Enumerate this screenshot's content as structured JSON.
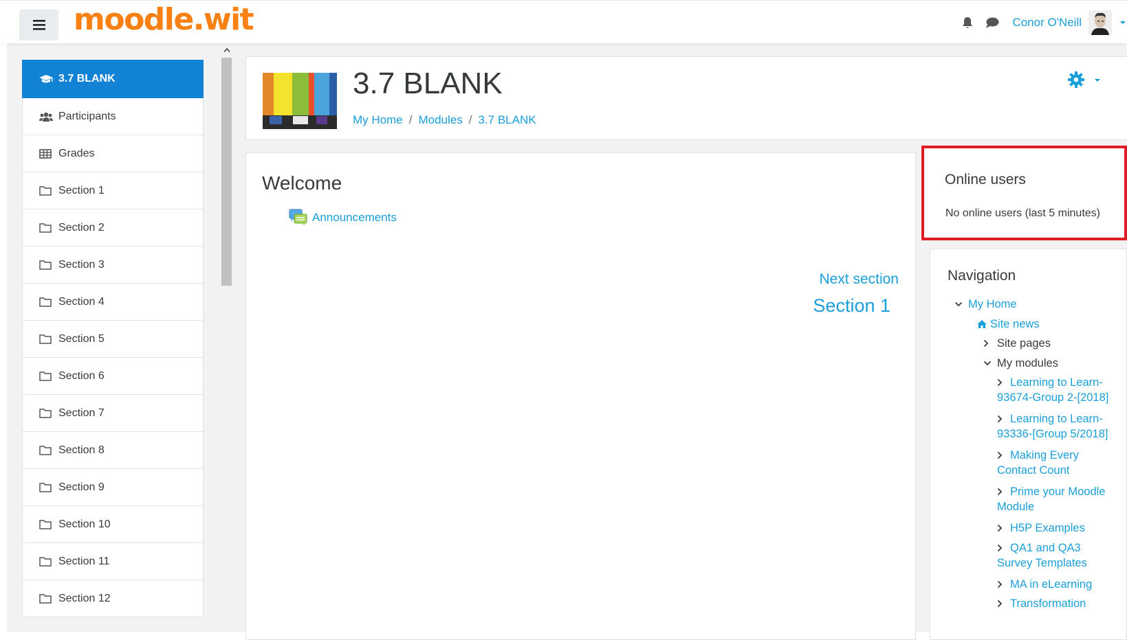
{
  "navbar": {
    "brand": "moodle.wit",
    "user_name": "Conor O'Neill",
    "icons": {
      "menu": "hamburger-menu-icon",
      "notifications": "bell-icon",
      "messages": "chat-bubble-icon",
      "user_menu": "caret-down-icon"
    }
  },
  "drawer": {
    "items": [
      {
        "label": "3.7 BLANK",
        "icon": "graduation-cap-icon",
        "active": true
      },
      {
        "label": "Participants",
        "icon": "users-icon"
      },
      {
        "label": "Grades",
        "icon": "table-icon"
      },
      {
        "label": "Section 1",
        "icon": "folder-icon"
      },
      {
        "label": "Section 2",
        "icon": "folder-icon"
      },
      {
        "label": "Section 3",
        "icon": "folder-icon"
      },
      {
        "label": "Section 4",
        "icon": "folder-icon"
      },
      {
        "label": "Section 5",
        "icon": "folder-icon"
      },
      {
        "label": "Section 6",
        "icon": "folder-icon"
      },
      {
        "label": "Section 7",
        "icon": "folder-icon"
      },
      {
        "label": "Section 8",
        "icon": "folder-icon"
      },
      {
        "label": "Section 9",
        "icon": "folder-icon"
      },
      {
        "label": "Section 10",
        "icon": "folder-icon"
      },
      {
        "label": "Section 11",
        "icon": "folder-icon"
      },
      {
        "label": "Section 12",
        "icon": "folder-icon"
      }
    ]
  },
  "header": {
    "title": "3.7 BLANK",
    "breadcrumb": [
      "My Home",
      "Modules",
      "3.7 BLANK"
    ],
    "breadcrumb_sep": "/",
    "settings_icon": "gear-icon"
  },
  "course": {
    "section_title": "Welcome",
    "activity": {
      "label": "Announcements",
      "icon": "forum-icon"
    },
    "next_label": "Next section",
    "next_section": "Section 1"
  },
  "online_users": {
    "title": "Online users",
    "text": "No online users (last 5 minutes)"
  },
  "navigation": {
    "title": "Navigation",
    "items": [
      {
        "label": "My Home",
        "expanded": true
      },
      {
        "label": "Site news",
        "icon": "home-icon"
      },
      {
        "label": "Site pages",
        "expanded": false
      },
      {
        "label": "My modules",
        "expanded": true
      },
      {
        "label": "Learning to Learn-93674-Group 2-[2018]"
      },
      {
        "label": "Learning to Learn-93336-[Group 5/2018]"
      },
      {
        "label": "Making Every Contact Count"
      },
      {
        "label": "Prime your Moodle Module"
      },
      {
        "label": "H5P Examples"
      },
      {
        "label": "QA1 and QA3 Survey Templates"
      },
      {
        "label": "MA in eLearning"
      },
      {
        "label": "Transformation"
      }
    ]
  },
  "colors": {
    "brand_orange": "#f98012",
    "link_blue": "#1a9fd9",
    "active_blue": "#1182d4",
    "highlight_red": "#e01b24"
  }
}
